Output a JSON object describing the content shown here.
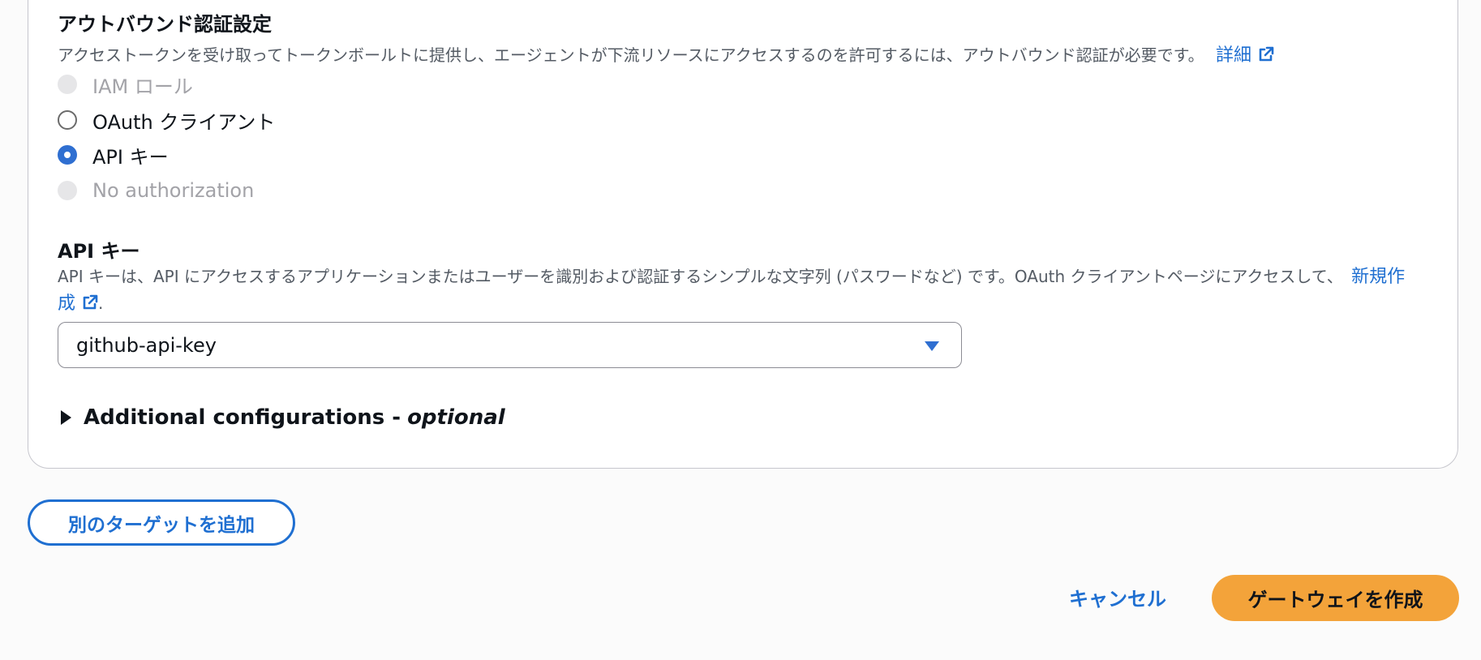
{
  "outbound": {
    "title": "アウトバウンド認証設定",
    "description": "アクセストークンを受け取ってトークンボールトに提供し、エージェントが下流リソースにアクセスするのを許可するには、アウトバウンド認証が必要です。",
    "details_link": "詳細",
    "options": [
      {
        "label": "IAM ロール",
        "state": "disabled"
      },
      {
        "label": "OAuth クライアント",
        "state": "unchecked"
      },
      {
        "label": "API キー",
        "state": "checked"
      },
      {
        "label": "No authorization",
        "state": "disabled"
      }
    ]
  },
  "api_key": {
    "title": "API キー",
    "description": "API キーは、API にアクセスするアプリケーションまたはユーザーを識別および認証するシンプルな文字列 (パスワードなど) です。OAuth クライアントページにアクセスして、",
    "create_link": "新規作成",
    "period": ".",
    "selected_value": "github-api-key"
  },
  "additional": {
    "label": "Additional configurations - ",
    "optional": "optional"
  },
  "buttons": {
    "add_target": "別のターゲットを追加",
    "cancel": "キャンセル",
    "create_gateway": "ゲートウェイを作成"
  },
  "colors": {
    "link": "#1f6fd1",
    "primary_button": "#f3a33a",
    "radio_checked": "#2f6fd1"
  }
}
